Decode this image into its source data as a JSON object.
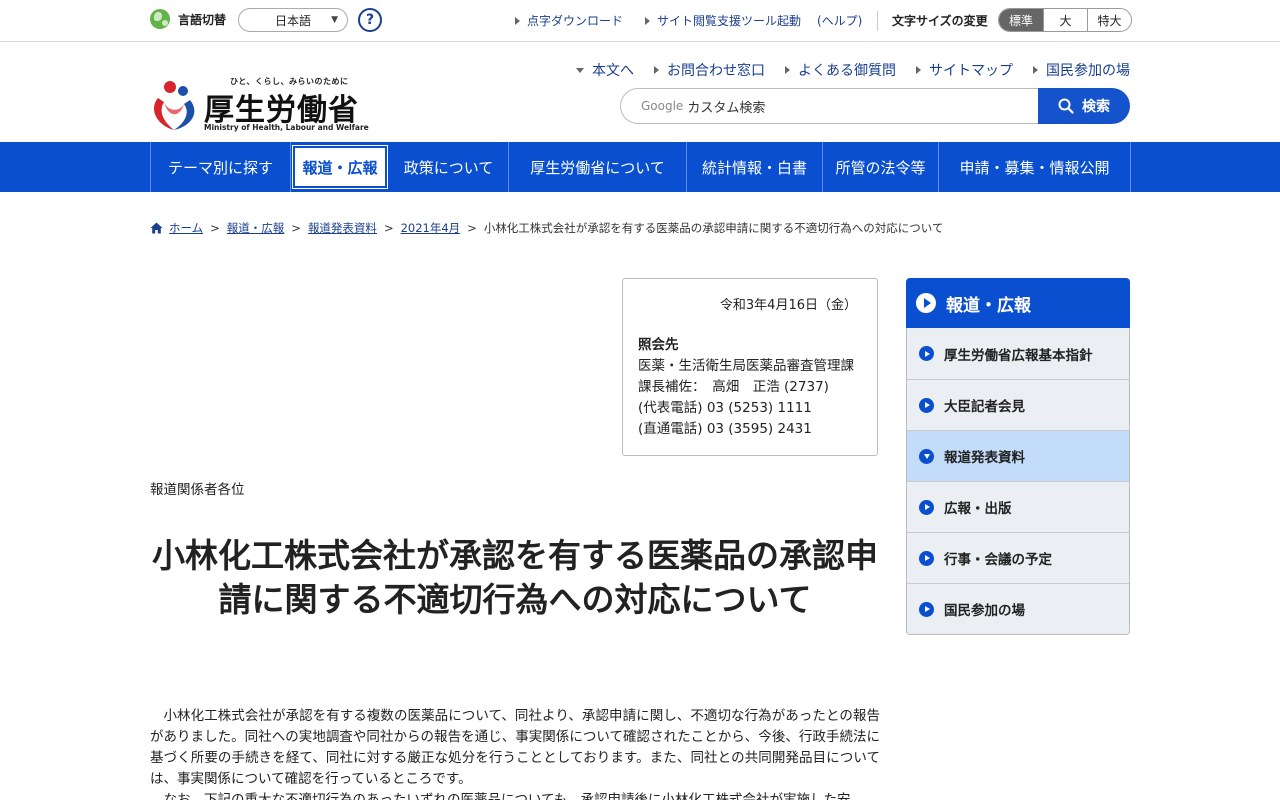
{
  "utility": {
    "lang_label": "言語切替",
    "lang_selected": "日本語",
    "help_label": "?",
    "links": [
      "点字ダウンロード",
      "サイト閲覧支援ツール起動",
      "(ヘルプ)"
    ],
    "fontsize_label": "文字サイズの変更",
    "fontsize_options": [
      "標準",
      "大",
      "特大"
    ]
  },
  "logo": {
    "tagline": "ひと、くらし、みらいのために",
    "title": "厚生労働省",
    "english": "Ministry of Health, Labour and Welfare"
  },
  "header_links": [
    "本文へ",
    "お問合わせ窓口",
    "よくある御質問",
    "サイトマップ",
    "国民参加の場"
  ],
  "search": {
    "google_label": "Google",
    "placeholder": "カスタム検索",
    "button_label": "検索"
  },
  "gnav": [
    "テーマ別に探す",
    "報道・広報",
    "政策について",
    "厚生労働省について",
    "統計情報・白書",
    "所管の法令等",
    "申請・募集・情報公開"
  ],
  "breadcrumb": {
    "items": [
      "ホーム",
      "報道・広報",
      "報道発表資料",
      "2021年4月"
    ],
    "current": "小林化工株式会社が承認を有する医薬品の承認申請に関する不適切行為への対応について",
    "separator": ">"
  },
  "contact": {
    "date": "令和3年4月16日（金）",
    "heading": "照会先",
    "lines": [
      "医薬・生活衛生局医薬品審査管理課",
      "課長補佐：　高畑　正浩 (2737)",
      "(代表電話) 03 (5253) 1111",
      "(直通電話) 03 (3595) 2431"
    ]
  },
  "addressee": "報道関係者各位",
  "title": "小林化工株式会社が承認を有する医薬品の承認申請に関する不適切行為への対応について",
  "body": [
    "小林化工株式会社が承認を有する複数の医薬品について、同社より、承認申請に関し、不適切な行為があったとの報告がありました。同社への実地調査や同社からの報告を通じ、事実関係について確認されたことから、今後、行政手続法に基づく所要の手続きを経て、同社に対する厳正な処分を行うこととしております。また、同社との共同開発品目については、事実関係について確認を行っているところです。",
    "なお、下記の重大な不適切行為のあったいずれの医薬品についても、承認申請後に小林化工株式会社が実施した安"
  ],
  "side": {
    "heading": "報道・広報",
    "items": [
      "厚生労働省広報基本指針",
      "大臣記者会見",
      "報道発表資料",
      "広報・出版",
      "行事・会議の予定",
      "国民参加の場"
    ],
    "current_index": 2
  },
  "colors": {
    "primary_blue": "#0a4fcf",
    "link_blue": "#1a3f8f",
    "side_current": "#c3dcfa",
    "side_bg": "#ebeef3"
  }
}
